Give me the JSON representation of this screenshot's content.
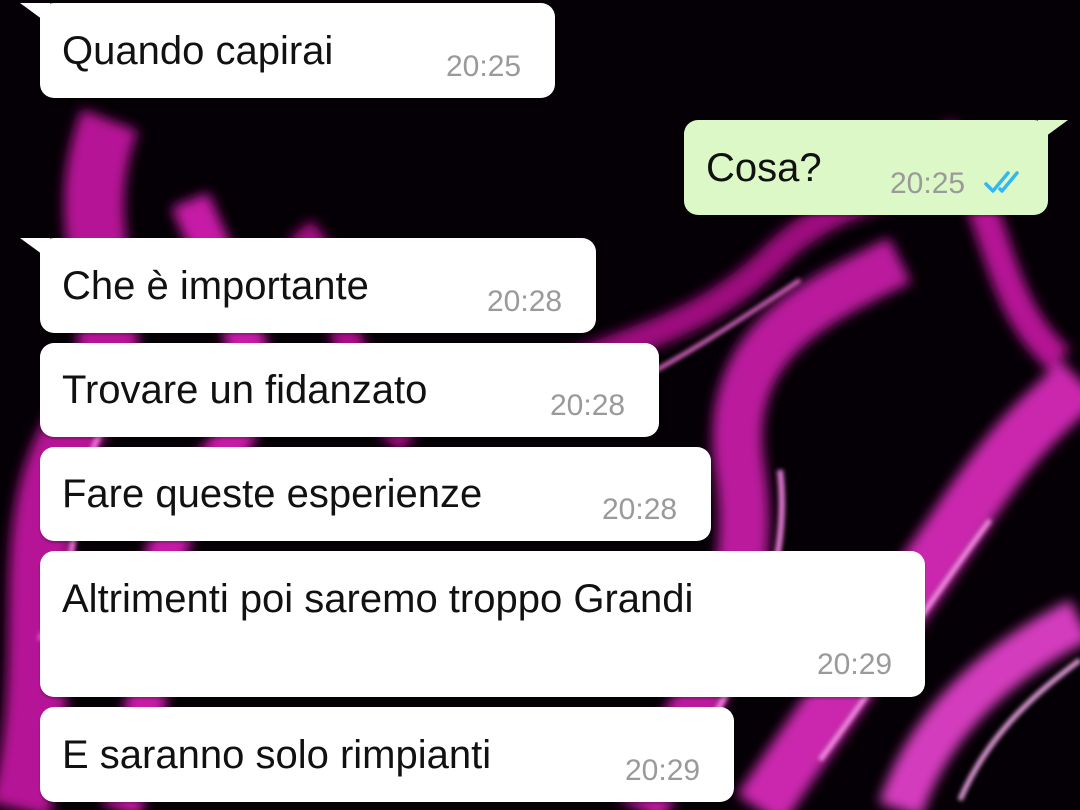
{
  "chat": {
    "colors": {
      "incoming_bubble": "#ffffff",
      "outgoing_bubble": "#dcf8c6",
      "time_text": "#9a9a9a",
      "read_ticks": "#34b7f1"
    },
    "wallpaper_icon": "pink-flames-wallpaper",
    "messages": [
      {
        "direction": "incoming",
        "text": "Quando capirai",
        "time": "20:25"
      },
      {
        "direction": "outgoing",
        "text": "Cosa?",
        "time": "20:25",
        "status_icon": "double-check-read-icon"
      },
      {
        "direction": "incoming",
        "text": "Che è importante",
        "time": "20:28"
      },
      {
        "direction": "incoming",
        "text": "Trovare un fidanzato",
        "time": "20:28"
      },
      {
        "direction": "incoming",
        "text": "Fare queste esperienze",
        "time": "20:28"
      },
      {
        "direction": "incoming",
        "text": "Altrimenti poi saremo troppo Grandi",
        "time": "20:29"
      },
      {
        "direction": "incoming",
        "text": "E saranno solo rimpianti",
        "time": "20:29"
      }
    ]
  }
}
